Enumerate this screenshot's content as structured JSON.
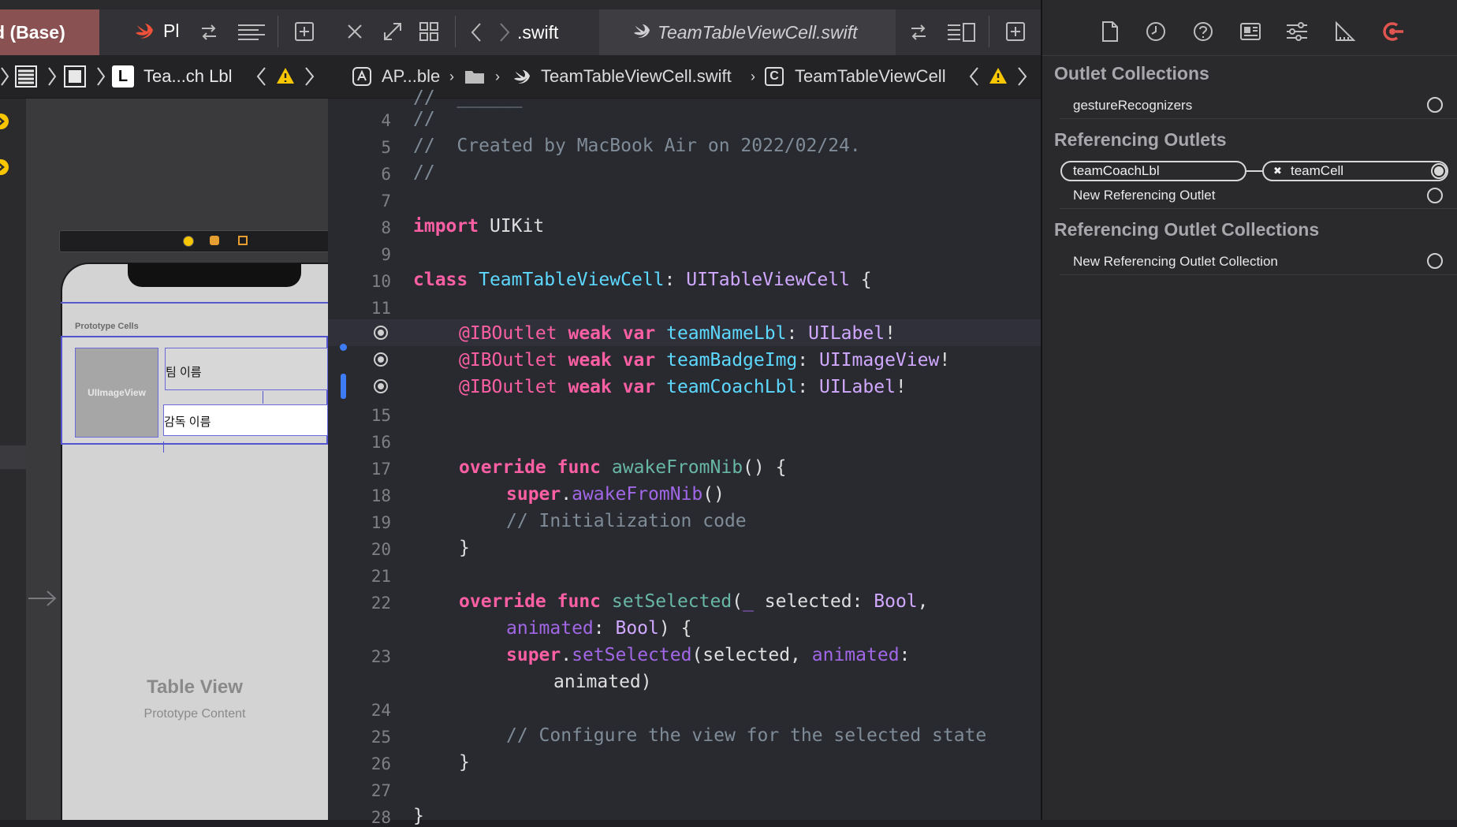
{
  "left_panel": {
    "tab_label": "d (Base)",
    "tab2_label": "Pl",
    "jump_bar_label": "Tea...ch Lbl",
    "jump_bar_badge": "L",
    "canvas": {
      "prototype_cells_label": "Prototype Cells",
      "image_view_label": "UIImageView",
      "label_team_name": "팀 이름",
      "label_coach_name": "감독 이름",
      "table_view_title": "Table View",
      "table_view_subtitle": "Prototype Content"
    }
  },
  "editor": {
    "tab_left": ".swift",
    "tab_active": "TeamTableViewCell.swift",
    "breadcrumb": {
      "project": "AP...ble",
      "file": "TeamTableViewCell.swift",
      "class_badge": "C",
      "class_name": "TeamTableViewCell"
    },
    "line_numbers": [
      "4",
      "5",
      "6",
      "7",
      "8",
      "9",
      "10",
      "11",
      "",
      "",
      "",
      "15",
      "16",
      "17",
      "18",
      "19",
      "20",
      "21",
      "22",
      "",
      "23",
      "",
      "24",
      "25",
      "26",
      "27",
      "28"
    ],
    "code": {
      "l4": "//",
      "l5": "//  Created by MacBook Air on 2022/02/24.",
      "l6": "//",
      "l8_kw": "import",
      "l8_rest": " UIKit",
      "l10_kw": "class",
      "l10_name": "TeamTableViewCell",
      "l10_colon": ": ",
      "l10_super": "UITableViewCell",
      "l10_brace": " {",
      "l12_attr": "@IBOutlet",
      "l12_kw": " weak var ",
      "l12_name": "teamNameLbl",
      "l12_type": "UILabel",
      "l13_name": "teamBadgeImg",
      "l13_type": "UIImageView",
      "l14_name": "teamCoachLbl",
      "l14_type": "UILabel",
      "l17_kw": "override func ",
      "l17_fn": "awakeFromNib",
      "l17_rest": "() {",
      "l18_kw": "super",
      "l18_fn": "awakeFromNib",
      "l18_rest": "()",
      "l19": "// Initialization code",
      "l20": "}",
      "l22_kw": "override func ",
      "l22_fn": "setSelected",
      "l22_rest1": "(",
      "l22_param": "_",
      "l22_rest2": " selected: ",
      "l22_type": "Bool",
      "l22_rest3": ",",
      "l22b_param": "animated",
      "l22b_rest": ": ",
      "l22b_type": "Bool",
      "l22b_end": ") {",
      "l23_kw": "super",
      "l23_fn": "setSelected",
      "l23_rest": "(selected, ",
      "l23_param": "animated",
      "l23_end": ":",
      "l23b": "animated)",
      "l25": "// Configure the view for the selected state",
      "l26": "}",
      "l28": "}"
    }
  },
  "inspector": {
    "outlet_collections_title": "Outlet Collections",
    "gesture_recognizers": "gestureRecognizers",
    "referencing_outlets_title": "Referencing Outlets",
    "connection_outlet": "teamCoachLbl",
    "connection_target": "teamCell",
    "remove_icon_glyph": "✖",
    "new_referencing_outlet": "New Referencing Outlet",
    "referencing_outlet_collections_title": "Referencing Outlet Collections",
    "new_referencing_outlet_collection": "New Referencing Outlet Collection"
  },
  "colors": {
    "keyword": "#fc5fa3",
    "type": "#5dd8ff",
    "system_type": "#d0a8ff",
    "function": "#67b7a4",
    "comment": "#7f8c98",
    "warning": "#f7c600",
    "accent_red": "#e0554f"
  }
}
